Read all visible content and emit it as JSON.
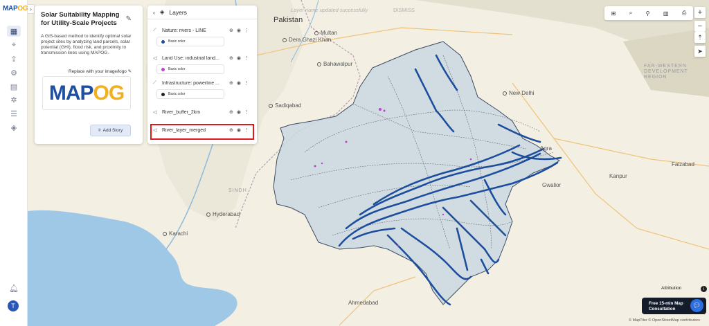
{
  "app": {
    "logo_main": "MAP",
    "logo_accent": "OG"
  },
  "rail": {
    "icons": [
      "map-icon",
      "pin-icon",
      "upload-icon",
      "settings-icon",
      "layers-stack-icon",
      "gear-icon",
      "list-icon",
      "stack-icon",
      "bell-icon"
    ],
    "avatar_letter": "T"
  },
  "story": {
    "title": "Solar Suitability Mapping for Utility-Scale Projects",
    "description": "A GIS-based method to identify optimal solar project sites by analyzing land parcels, solar potential (GHI), flood risk, and proximity to transmission lines using MAPOG.",
    "replace_label": "Replace with your image/logo",
    "logo_main": "MAP",
    "logo_accent": "OG",
    "add_story_label": "Add Story"
  },
  "layers_panel": {
    "title": "Layers",
    "items": [
      {
        "name": "Nature: rivers - LINE",
        "type_icon": "line",
        "color_label": "Basic color",
        "color": "#1d4e9e"
      },
      {
        "name": "Land Use: industrial land...",
        "type_icon": "polygon",
        "color_label": "Basic color",
        "color": "#c040d0"
      },
      {
        "name": "Infrastructure: powerline ...",
        "type_icon": "line",
        "color_label": "Basic color",
        "color": "#222222"
      },
      {
        "name": "River_buffer_2km",
        "type_icon": "polygon"
      },
      {
        "name": "River_layer_merged",
        "type_icon": "polygon"
      }
    ]
  },
  "toast": {
    "message": "Layer name updated successfully",
    "dismiss": "DISMISS"
  },
  "map_labels": {
    "pakistan": "Pakistan",
    "multan": "Multan",
    "dera_ghazi_khan": "Dera Ghazi Khan",
    "bahawalpur": "Bahawalpur",
    "sadiqabad": "Sadiqabad",
    "sindh": "SINDH",
    "hyderabad": "Hyderabad",
    "karachi": "Karachi",
    "ahmedabad": "Ahmedabad",
    "new_delhi": "New Delhi",
    "agra": "Agra",
    "gwalior": "Gwalior",
    "kanpur": "Kanpur",
    "faizabad": "Faizabad",
    "far_western": "FAR-WESTERN DEVELOPMENT REGION"
  },
  "footer": {
    "attribution": "Attribution",
    "consult_line1": "Free 15-min Map",
    "consult_line2": "Consultation",
    "copyright": "© MapTiler © OpenStreetMap contributors"
  }
}
